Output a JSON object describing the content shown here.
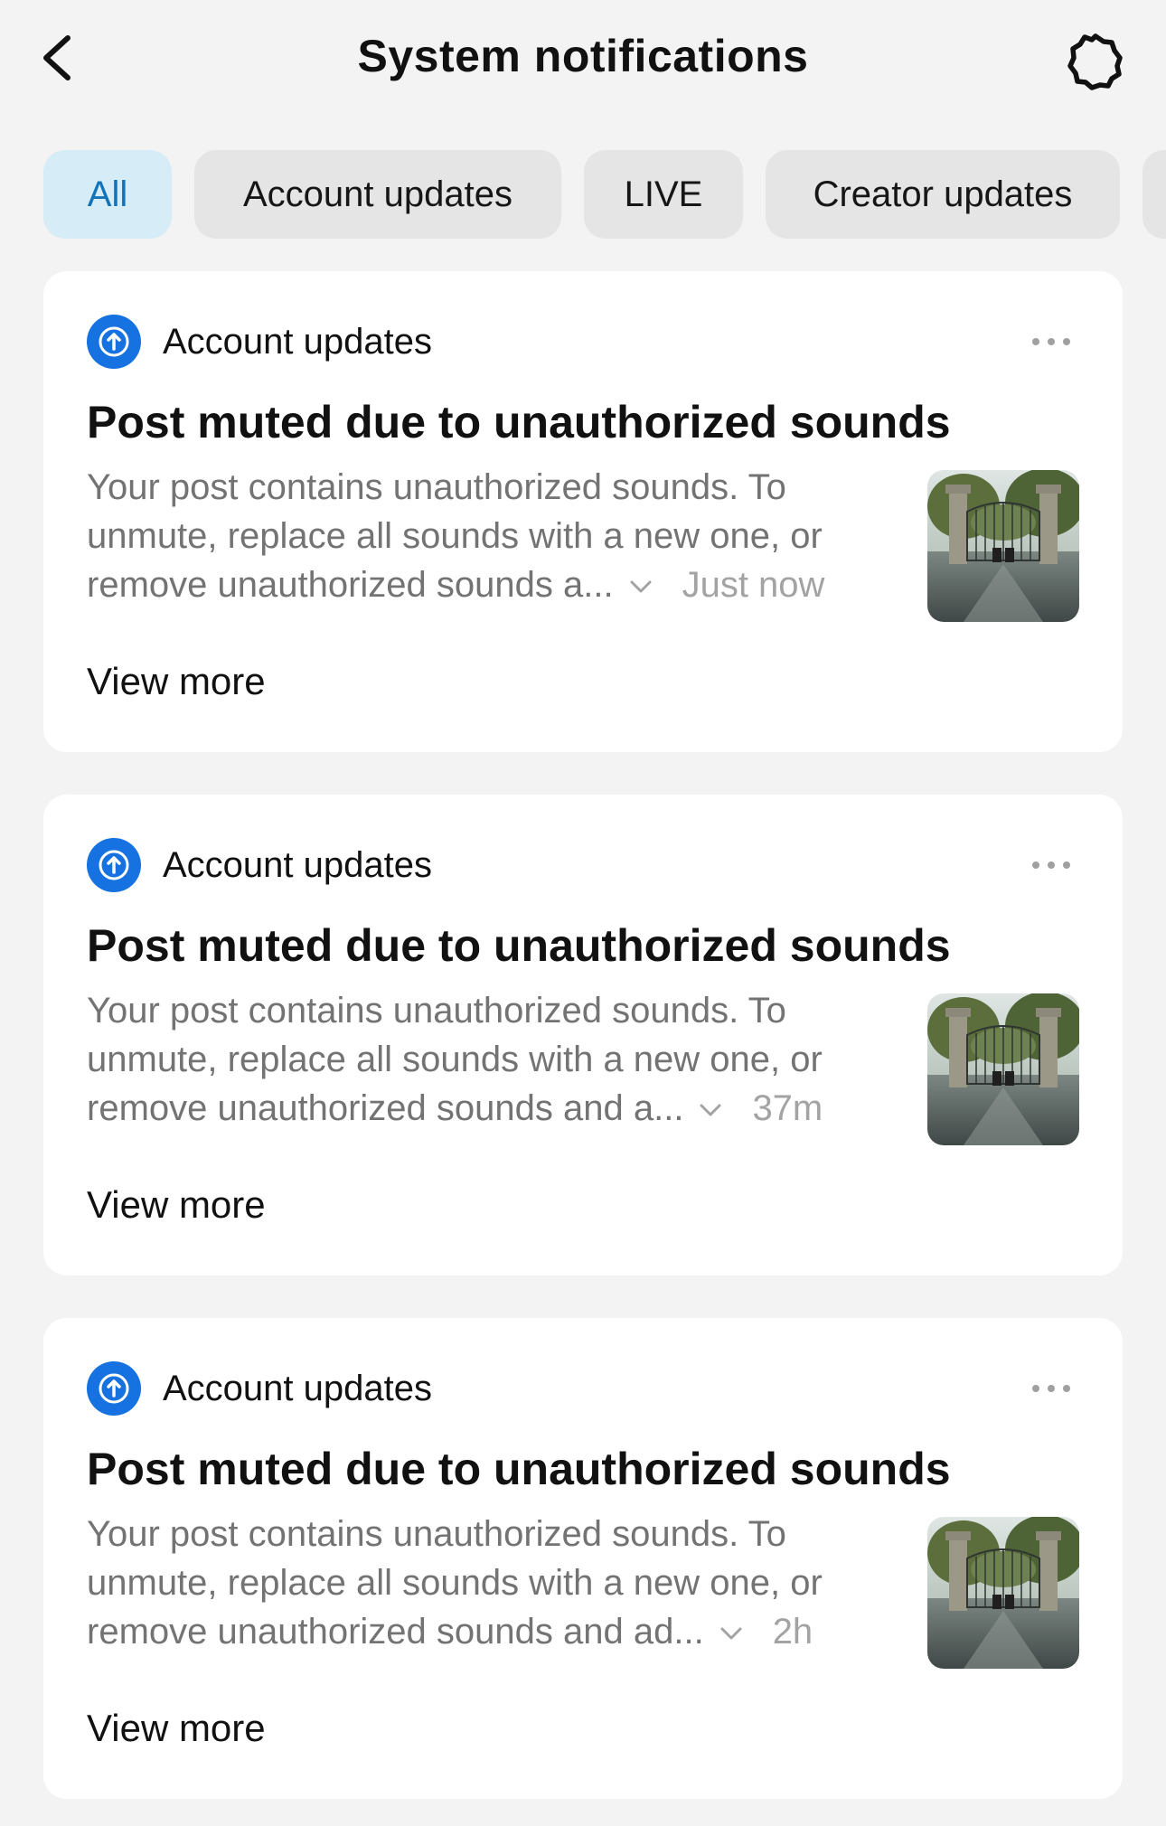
{
  "header": {
    "title": "System notifications",
    "back_icon": "chevron-left-icon",
    "settings_icon": "gear-icon"
  },
  "tabs": [
    {
      "label": "All",
      "active": true
    },
    {
      "label": "Account updates",
      "active": false
    },
    {
      "label": "LIVE",
      "active": false
    },
    {
      "label": "Creator updates",
      "active": false
    }
  ],
  "colors": {
    "accent_blue": "#1672e0",
    "active_tab_bg": "#d6ecf7",
    "active_tab_text": "#1473b8",
    "page_bg": "#f3f3f3"
  },
  "notifications": [
    {
      "category": "Account updates",
      "category_icon": "upload-arrow-icon",
      "title": "Post muted due to unauthorized sounds",
      "body_line1": "Your post contains unauthorized sounds. To",
      "body_line2": "unmute, replace all sounds with a new one, or",
      "body_line3": "remove unauthorized sounds a...",
      "time": "Just now",
      "view_more": "View more"
    },
    {
      "category": "Account updates",
      "category_icon": "upload-arrow-icon",
      "title": "Post muted due to unauthorized sounds",
      "body_line1": "Your post contains unauthorized sounds. To",
      "body_line2": "unmute, replace all sounds with a new one, or",
      "body_line3": "remove unauthorized sounds and a...",
      "time": "37m",
      "view_more": "View more"
    },
    {
      "category": "Account updates",
      "category_icon": "upload-arrow-icon",
      "title": "Post muted due to unauthorized sounds",
      "body_line1": "Your post contains unauthorized sounds. To",
      "body_line2": "unmute, replace all sounds with a new one, or",
      "body_line3": "remove unauthorized sounds and ad...",
      "time": "2h",
      "view_more": "View more"
    }
  ]
}
